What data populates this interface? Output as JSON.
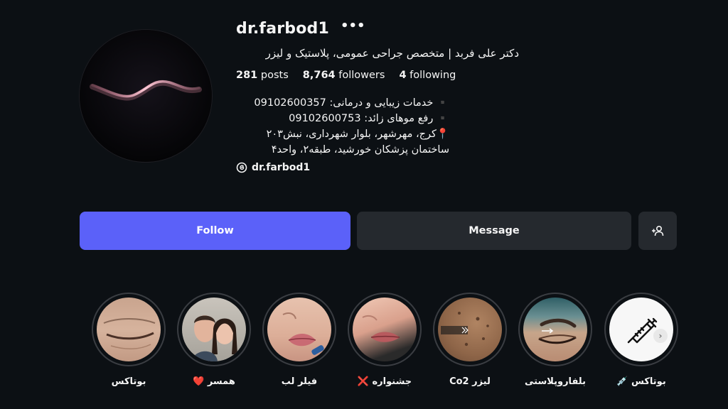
{
  "profile": {
    "username": "dr.farbod1",
    "more_icon": "•••",
    "full_name": "دکتر علی فربد | متخصص جراحی عمومی، پلاستیک و لیزر",
    "stats": {
      "posts_count": "281",
      "posts_label": "posts",
      "followers_count": "8,764",
      "followers_label": "followers",
      "following_count": "4",
      "following_label": "following"
    },
    "bio": [
      "▪️ خدمات زیبایی و درمانی: 09102600357",
      "▪️ رفع موهای زائد: 09102600753",
      "📍کرج، مهرشهر، بلوار شهرداری، نبش۲۰۳",
      "ساختمان پزشکان خورشید، طبقه۲، واحد۴"
    ],
    "threads_handle": "dr.farbod1"
  },
  "actions": {
    "follow_label": "Follow",
    "message_label": "Message",
    "add_user_icon": "add-user-icon"
  },
  "colors": {
    "background": "#0c1014",
    "follow_button": "#5b61f9",
    "secondary_button": "#25292e",
    "ring": "#3a3d42"
  },
  "highlights": [
    {
      "label": "بوتاکس 💉"
    },
    {
      "label": "بلفاروپلاستی"
    },
    {
      "label": "لیزر Co2"
    },
    {
      "label": "جشنواره ❌"
    },
    {
      "label": "فیلر لب"
    },
    {
      "label": "همسر ❤️"
    },
    {
      "label": "بوتاکس"
    }
  ]
}
